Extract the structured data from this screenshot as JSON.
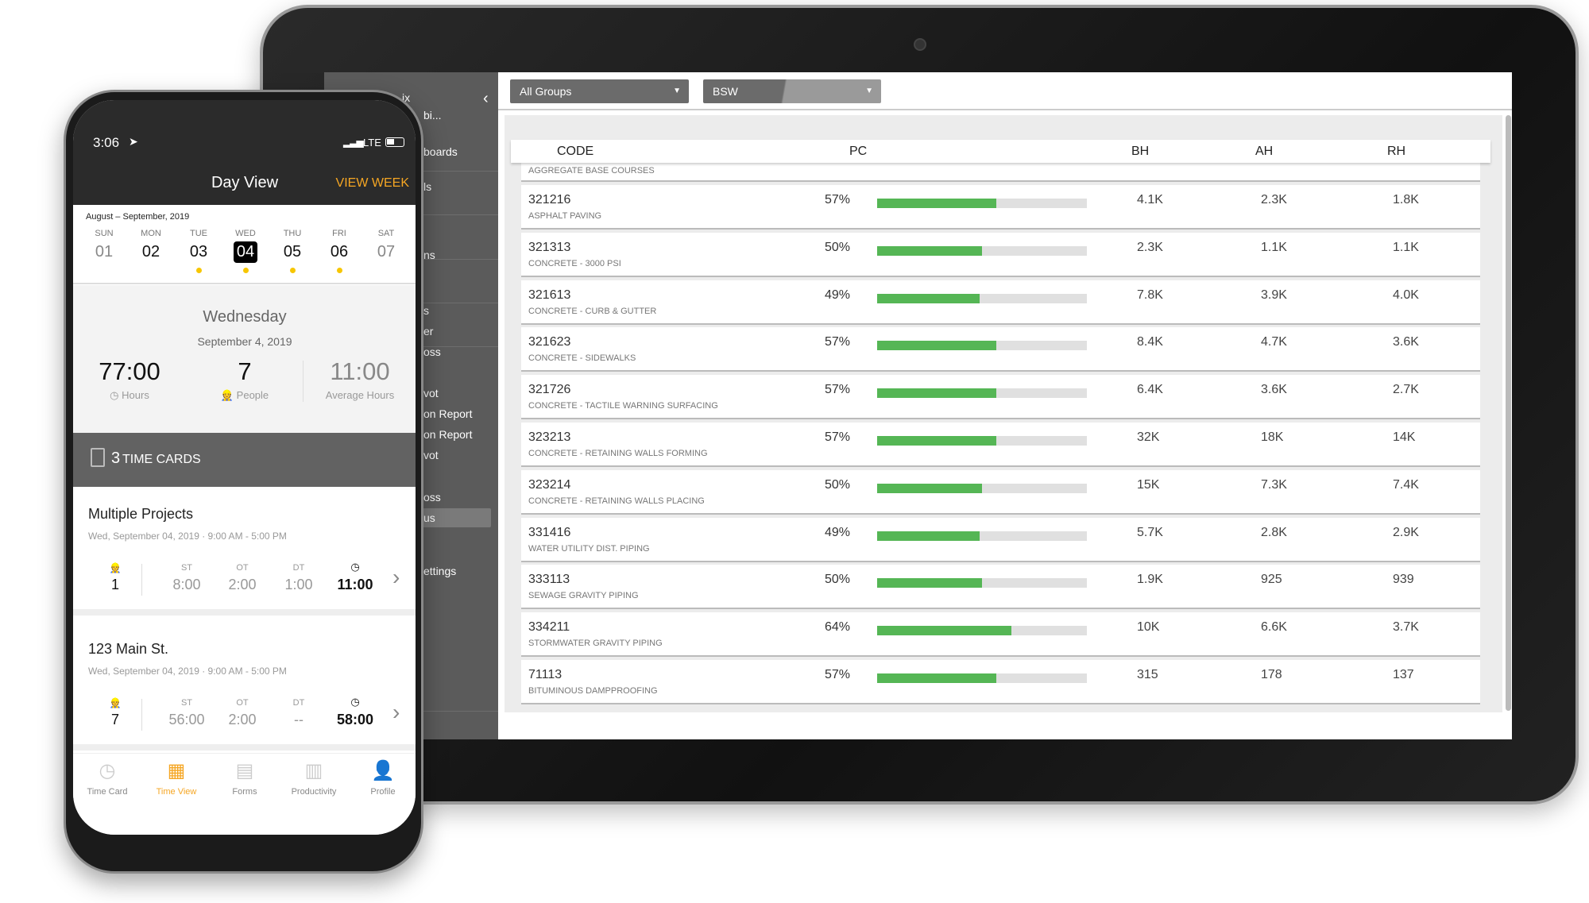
{
  "tablet": {
    "sidebar": {
      "collapse_icon": "chevron-left-icon",
      "items": [
        "ix",
        "bi...",
        "boards",
        "ls",
        "ns",
        "s",
        "er",
        "oss",
        "vot",
        "on Report",
        "on Report",
        "vot",
        "oss",
        "us",
        "ettings"
      ],
      "active_item": "us"
    },
    "filters": {
      "group": "All Groups",
      "project": "BSW"
    },
    "table": {
      "columns": [
        "CODE",
        "PC",
        "BH",
        "AH",
        "RH"
      ],
      "partial_row": "AGGREGATE BASE COURSES",
      "rows": [
        {
          "code": "321216",
          "desc": "ASPHALT PAVING",
          "pc": "57%",
          "pc_value": 57,
          "bh": "4.1K",
          "ah": "2.3K",
          "rh": "1.8K"
        },
        {
          "code": "321313",
          "desc": "CONCRETE - 3000 PSI",
          "pc": "50%",
          "pc_value": 50,
          "bh": "2.3K",
          "ah": "1.1K",
          "rh": "1.1K"
        },
        {
          "code": "321613",
          "desc": "CONCRETE - CURB & GUTTER",
          "pc": "49%",
          "pc_value": 49,
          "bh": "7.8K",
          "ah": "3.9K",
          "rh": "4.0K"
        },
        {
          "code": "321623",
          "desc": "CONCRETE - SIDEWALKS",
          "pc": "57%",
          "pc_value": 57,
          "bh": "8.4K",
          "ah": "4.7K",
          "rh": "3.6K"
        },
        {
          "code": "321726",
          "desc": "CONCRETE - TACTILE WARNING SURFACING",
          "pc": "57%",
          "pc_value": 57,
          "bh": "6.4K",
          "ah": "3.6K",
          "rh": "2.7K"
        },
        {
          "code": "323213",
          "desc": "CONCRETE - RETAINING WALLS FORMING",
          "pc": "57%",
          "pc_value": 57,
          "bh": "32K",
          "ah": "18K",
          "rh": "14K"
        },
        {
          "code": "323214",
          "desc": "CONCRETE - RETAINING WALLS PLACING",
          "pc": "50%",
          "pc_value": 50,
          "bh": "15K",
          "ah": "7.3K",
          "rh": "7.4K"
        },
        {
          "code": "331416",
          "desc": "WATER UTILITY DIST. PIPING",
          "pc": "49%",
          "pc_value": 49,
          "bh": "5.7K",
          "ah": "2.8K",
          "rh": "2.9K"
        },
        {
          "code": "333113",
          "desc": "SEWAGE GRAVITY PIPING",
          "pc": "50%",
          "pc_value": 50,
          "bh": "1.9K",
          "ah": "925",
          "rh": "939"
        },
        {
          "code": "334211",
          "desc": "STORMWATER GRAVITY PIPING",
          "pc": "64%",
          "pc_value": 64,
          "bh": "10K",
          "ah": "6.6K",
          "rh": "3.7K"
        },
        {
          "code": "71113",
          "desc": "BITUMINOUS DAMPPROOFING",
          "pc": "57%",
          "pc_value": 57,
          "bh": "315",
          "ah": "178",
          "rh": "137"
        }
      ]
    },
    "colors": {
      "bar_fill": "#55b655",
      "bar_track": "#e0e0e0",
      "sidebar": "#5b5b5b"
    }
  },
  "phone": {
    "status": {
      "time": "3:06",
      "network": "LTE"
    },
    "header": {
      "title": "Day View",
      "action": "VIEW WEEK"
    },
    "calendar": {
      "range": "August – September,  2019",
      "days": [
        {
          "dow": "SUN",
          "num": "01",
          "dot": false
        },
        {
          "dow": "MON",
          "num": "02",
          "dot": false
        },
        {
          "dow": "TUE",
          "num": "03",
          "dot": true
        },
        {
          "dow": "WED",
          "num": "04",
          "dot": true,
          "selected": true
        },
        {
          "dow": "THU",
          "num": "05",
          "dot": true
        },
        {
          "dow": "FRI",
          "num": "06",
          "dot": true
        },
        {
          "dow": "SAT",
          "num": "07",
          "dot": false
        }
      ]
    },
    "summary": {
      "weekday": "Wednesday",
      "date": "September 4, 2019",
      "hours": "77:00",
      "hours_label": "Hours",
      "people": "7",
      "people_label": "People",
      "avg": "11:00",
      "avg_label": "Average Hours"
    },
    "time_cards": {
      "count": "3",
      "label": "TIME CARDS"
    },
    "cards": [
      {
        "title": "Multiple Projects",
        "subtitle": "Wed, September 04, 2019 · 9:00 AM - 5:00 PM",
        "people": "1",
        "st_label": "ST",
        "st": "8:00",
        "ot_label": "OT",
        "ot": "2:00",
        "dt_label": "DT",
        "dt": "1:00",
        "total": "11:00"
      },
      {
        "title": "123 Main St.",
        "subtitle": "Wed, September 04, 2019 · 9:00 AM - 5:00 PM",
        "people": "7",
        "st_label": "ST",
        "st": "56:00",
        "ot_label": "OT",
        "ot": "2:00",
        "dt_label": "DT",
        "dt": "--",
        "total": "58:00"
      }
    ],
    "tabs": [
      {
        "label": "Time Card",
        "icon": "time-card-icon"
      },
      {
        "label": "Time View",
        "icon": "calendar-icon",
        "active": true
      },
      {
        "label": "Forms",
        "icon": "forms-icon"
      },
      {
        "label": "Productivity",
        "icon": "bar-chart-icon"
      },
      {
        "label": "Profile",
        "icon": "profile-icon"
      }
    ],
    "colors": {
      "accent": "#f5a623",
      "header": "#2b2b2b",
      "dot": "#f7c600"
    }
  }
}
